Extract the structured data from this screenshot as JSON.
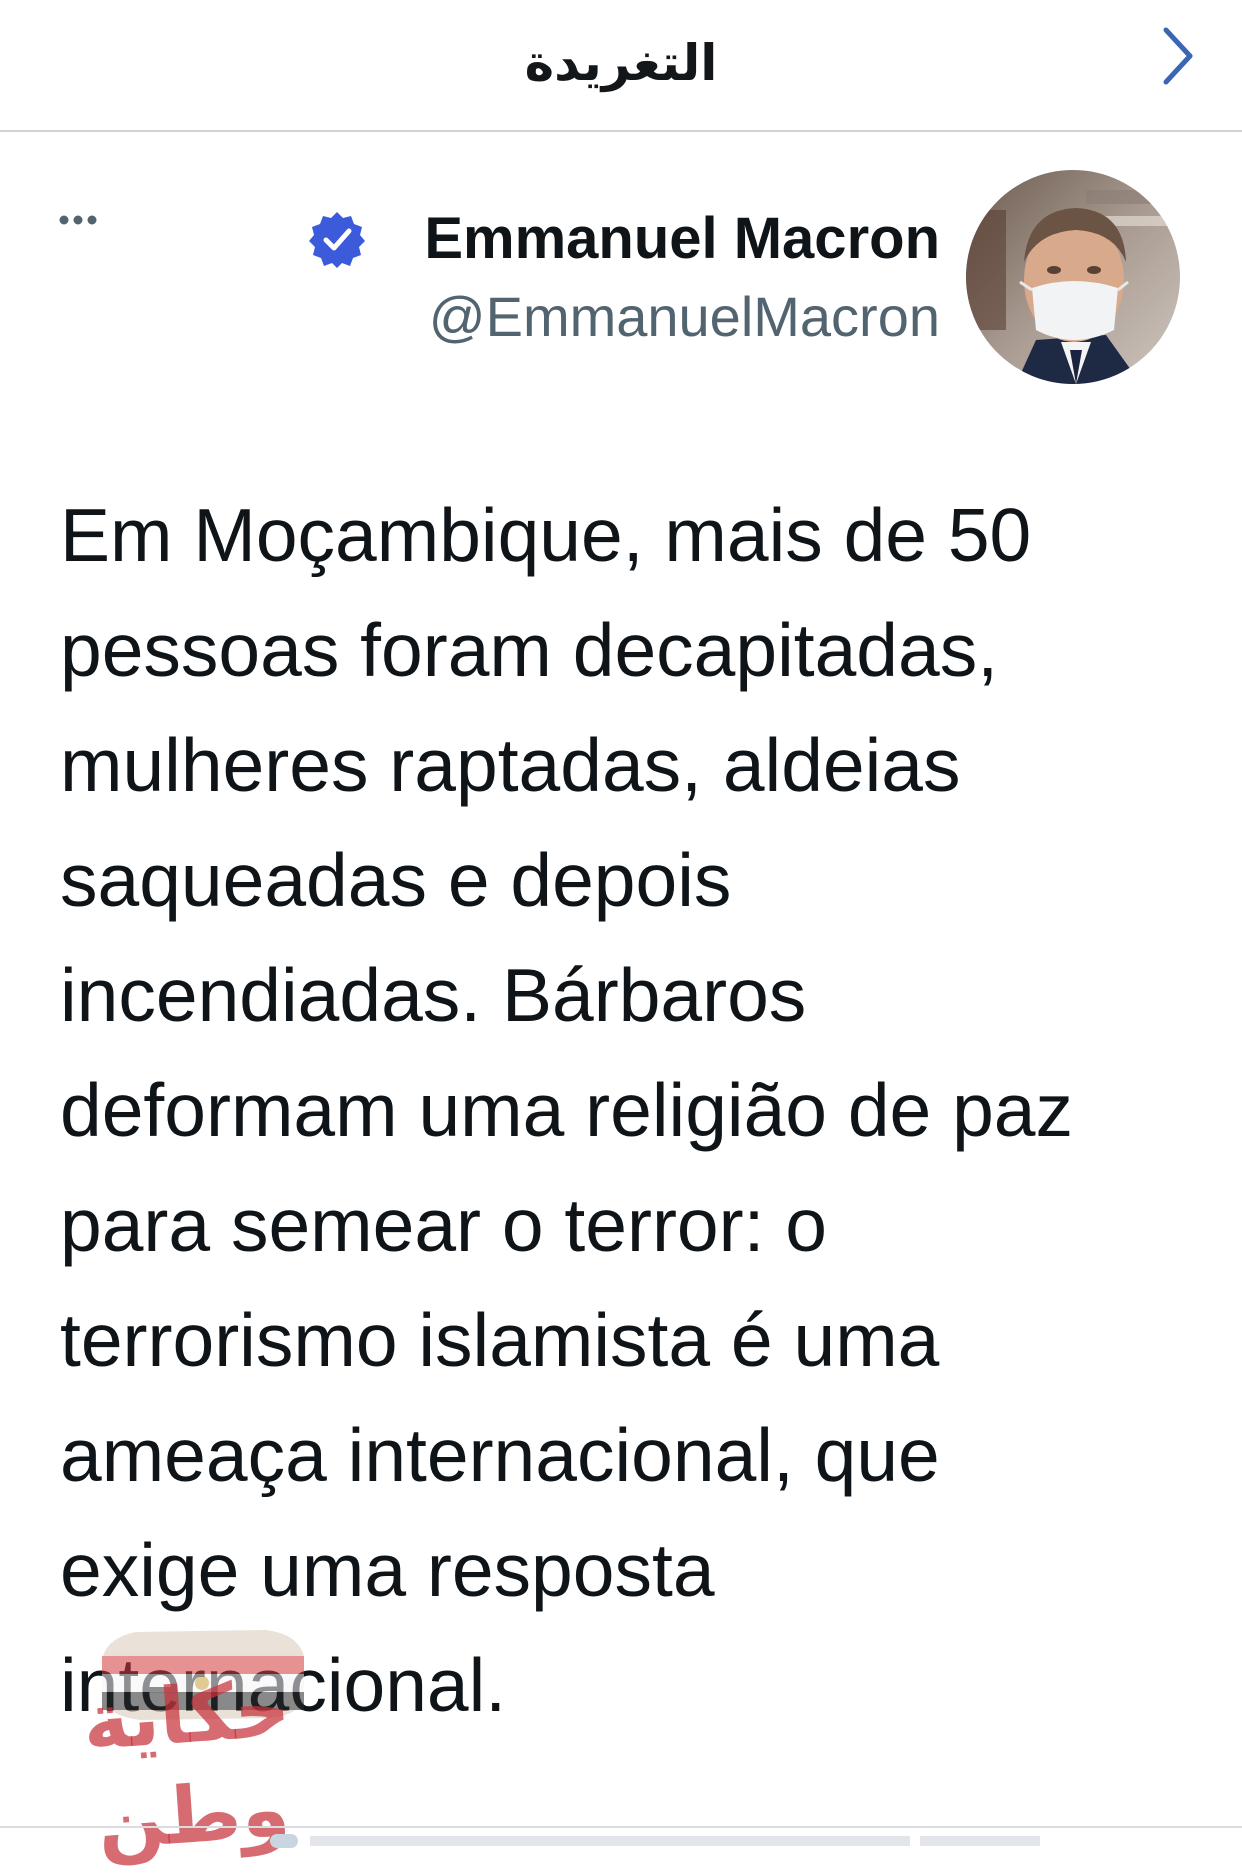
{
  "header": {
    "title": "التغريدة",
    "back_icon": "chevron-right-icon"
  },
  "tweet": {
    "author": {
      "name": "Emmanuel Macron",
      "handle": "@EmmanuelMacron",
      "verified": true,
      "verified_icon": "verified-badge-icon",
      "avatar_icon": "profile-photo"
    },
    "more_icon": "more-horizontal-icon",
    "text_lines": [
      "Em Moçambique, mais de 50",
      "pessoas foram decapitadas,",
      "mulheres raptadas, aldeias",
      "saqueadas e depois",
      "incendiadas. Bárbaros",
      "deformam uma religião de paz",
      "para semear o terror: o",
      "terrorismo islamista é uma",
      "ameaça internacional, que",
      "exige uma resposta",
      "internacional."
    ]
  },
  "watermark": {
    "text": "حكاية وطن"
  },
  "colors": {
    "accent": "#1d9bf0",
    "verified": "#3b5bdb",
    "text": "#0f1419",
    "secondary_text": "#536471",
    "divider": "#cfd3d6",
    "watermark": "#c8323c"
  }
}
